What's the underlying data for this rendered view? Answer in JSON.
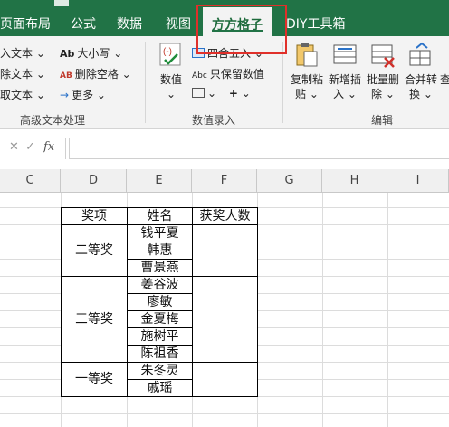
{
  "tabs": {
    "page_layout": "页面布局",
    "formulas": "公式",
    "data": "数据",
    "view": "视图",
    "fangfang": "方方格子",
    "diy": "DIY工具箱"
  },
  "ribbon": {
    "text_group": {
      "insert_text": "入文本",
      "delete_text": "除文本",
      "extract_text": "取文本",
      "case": "大小写",
      "delete_spaces": "删除空格",
      "more": "更多",
      "label": "高级文本处理",
      "case_icon": "Ab",
      "spaces_icon": "AB"
    },
    "number_group": {
      "numeric": "数值",
      "round": "四舍五入",
      "keep_numbers": "只保留数值",
      "label": "数值录入",
      "keep_icon": "Abc",
      "plus": "+"
    },
    "edit_group": {
      "copy_paste": [
        "复制粘",
        "贴"
      ],
      "insert_new": [
        "新增插",
        "入"
      ],
      "batch_delete": [
        "批量删",
        "除"
      ],
      "merge_convert": [
        "合并转",
        "换"
      ],
      "find": "查",
      "label": "编辑"
    }
  },
  "formula_bar": {
    "cancel_glyph": "✕",
    "confirm_glyph": "✓",
    "fx": "fx",
    "content": ""
  },
  "columns": [
    "C",
    "D",
    "E",
    "F",
    "G",
    "H",
    "I"
  ],
  "table": {
    "headers": [
      "奖项",
      "姓名",
      "获奖人数"
    ],
    "groups": [
      {
        "award": "二等奖",
        "names": [
          "钱平夏",
          "韩惠",
          "曹景燕"
        ],
        "count": ""
      },
      {
        "award": "三等奖",
        "names": [
          "姜谷波",
          "廖敏",
          "金夏梅",
          "施树平",
          "陈祖香"
        ],
        "count": ""
      },
      {
        "award": "一等奖",
        "names": [
          "朱冬灵",
          "戚瑶"
        ],
        "count": ""
      }
    ]
  },
  "colors": {
    "excel_green": "#217346",
    "ribbon_bg": "#f3f3f3",
    "highlight_red": "#e0302a",
    "table_border": "#000000"
  }
}
